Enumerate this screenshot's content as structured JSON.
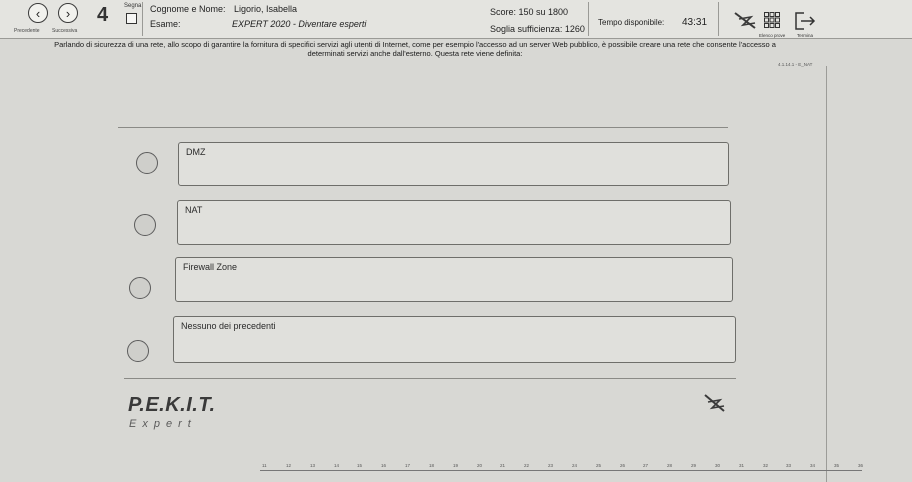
{
  "nav": {
    "prev_label": "Precedente",
    "next_label": "Successiva",
    "question_number": "4",
    "segna_label": "Segna"
  },
  "header": {
    "name_label": "Cognome e Nome:",
    "name_value": "Ligorio, Isabella",
    "exam_label": "Esame:",
    "exam_value": "EXPERT 2020 - Diventare esperti",
    "score_text": "Score: 150 su 1800",
    "threshold_text": "Soglia sufficienza: 1260",
    "time_label": "Tempo disponibile:",
    "time_value": "43:31",
    "review_label": "Elenco prove",
    "end_label": "Termina"
  },
  "question": {
    "text_line1": "Parlando di sicurezza di una rete, allo scopo di garantire la fornitura di specifici servizi agli utenti di Internet, come per esempio l'accesso ad un server Web pubblico, è possibile creare una rete che consente l'accesso a",
    "text_line2": "determinati servizi anche dall'esterno. Questa rete viene definita:",
    "code": "4.1.14.1 - E_NAT"
  },
  "options": [
    {
      "label": "DMZ"
    },
    {
      "label": "NAT"
    },
    {
      "label": "Firewall Zone"
    },
    {
      "label": "Nessuno dei precedenti"
    }
  ],
  "brand": {
    "name": "P.E.K.I.T.",
    "sub": "Expert"
  },
  "timeline": {
    "labels": [
      "11",
      "12",
      "13",
      "14",
      "15",
      "16",
      "17",
      "18",
      "19",
      "20",
      "21",
      "22",
      "23",
      "24",
      "25",
      "26",
      "27",
      "28",
      "29",
      "30",
      "31",
      "32",
      "33",
      "34",
      "35",
      "36"
    ]
  },
  "colors": {
    "background": "#d8d8d4",
    "option_box": "#e0e0dc",
    "border": "#6e6e6a"
  }
}
